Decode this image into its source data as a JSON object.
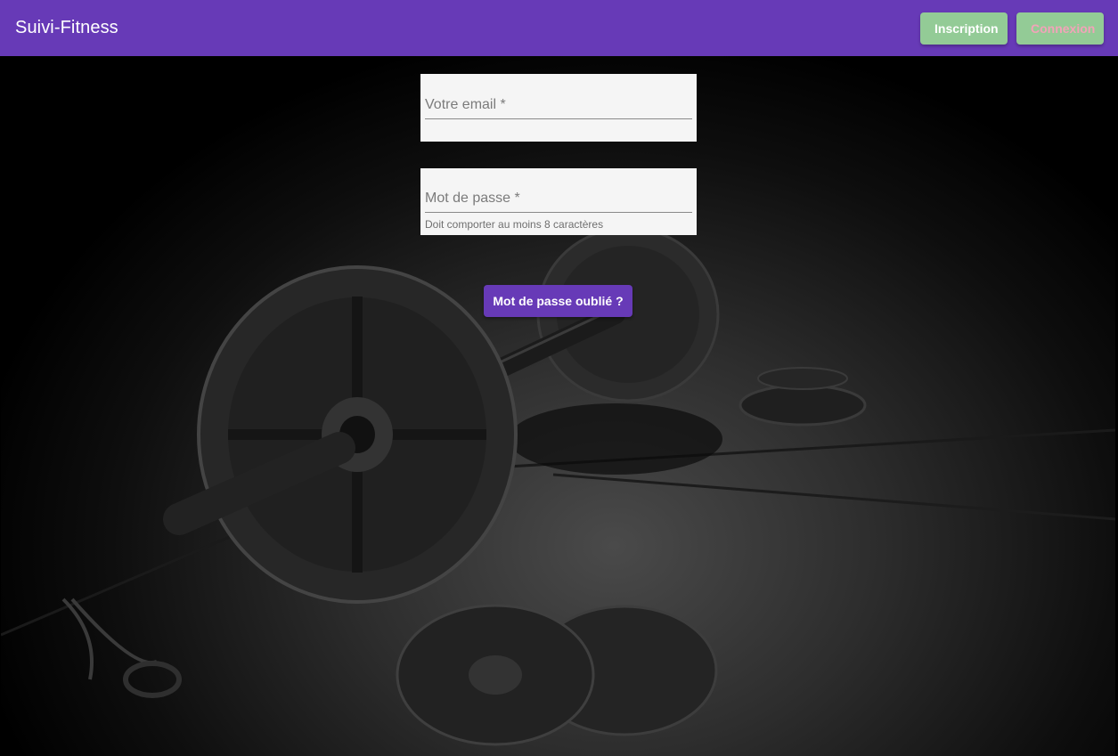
{
  "header": {
    "title": "Suivi-Fitness",
    "inscription_label": "Inscription",
    "connexion_label": "Connexion"
  },
  "login_form": {
    "email_placeholder": "Votre email *",
    "email_value": "",
    "password_placeholder": "Mot de passe *",
    "password_value": "",
    "password_hint": "Doit comporter au moins 8 caractères",
    "forgot_label": "Mot de passe oublié ?"
  },
  "colors": {
    "primary": "#673ab7",
    "nav_button": "#93cb96",
    "field_background": "#f5f5f5"
  }
}
